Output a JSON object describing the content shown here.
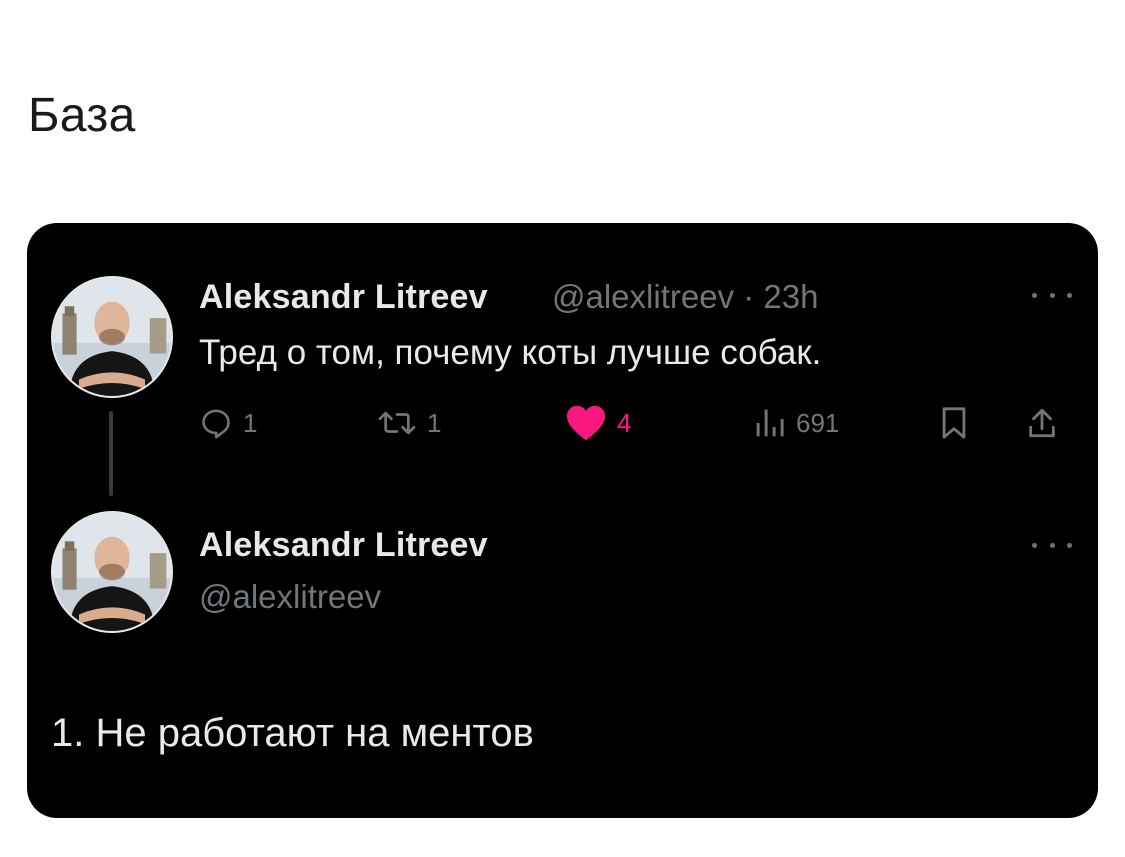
{
  "post": {
    "caption": "База"
  },
  "tweet": {
    "author_name": "Aleksandr Litreev",
    "handle_time": "@alexlitreev · 23h",
    "text": "Тред о том, почему коты лучше собак.",
    "actions": {
      "replies": "1",
      "reposts": "1",
      "likes": "4",
      "views": "691"
    },
    "like_color": "#f91880"
  },
  "reply": {
    "author_name": "Aleksandr Litreev",
    "handle": "@alexlitreev",
    "text": "1. Не работают на ментов"
  },
  "icons": [
    "more-icon",
    "reply-icon",
    "repost-icon",
    "heart-icon",
    "views-icon",
    "bookmark-icon",
    "share-icon"
  ]
}
